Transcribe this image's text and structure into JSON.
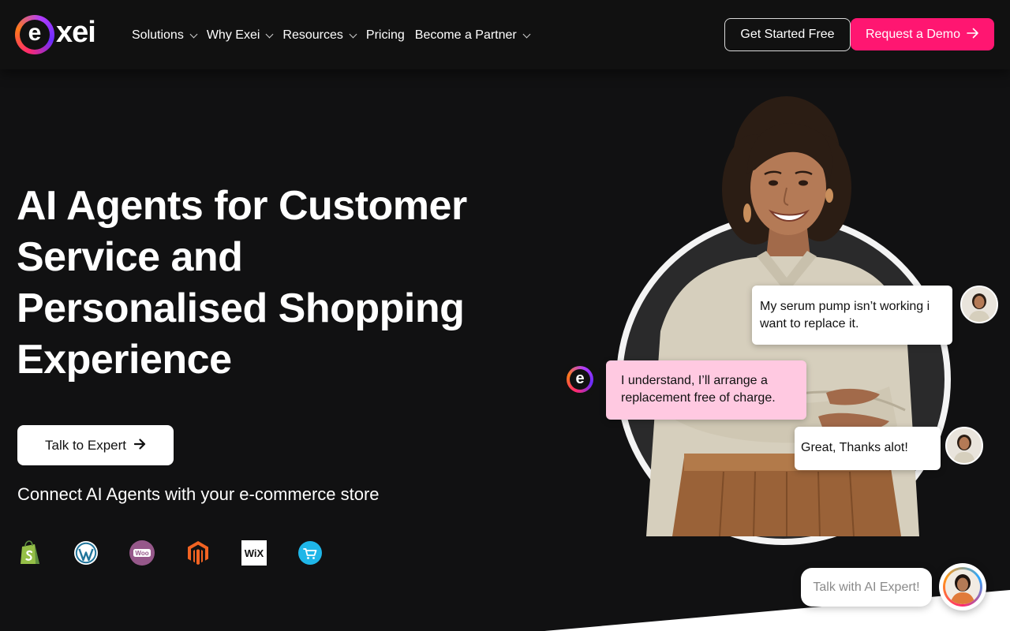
{
  "brand": {
    "logo_letter": "e",
    "logo_text": "xei"
  },
  "nav": {
    "items": [
      {
        "label": "Solutions",
        "has_dropdown": true
      },
      {
        "label": "Why Exei",
        "has_dropdown": true
      },
      {
        "label": "Resources",
        "has_dropdown": true
      },
      {
        "label": "Pricing",
        "has_dropdown": false
      },
      {
        "label": "Become a Partner",
        "has_dropdown": true
      }
    ],
    "get_started_label": "Get Started Free",
    "request_demo_label": "Request a Demo"
  },
  "hero": {
    "title_lines": [
      "AI Agents for Customer",
      "Service and",
      "Personalised Shopping",
      "Experience"
    ],
    "cta_label": "Talk to Expert",
    "connect_text": "Connect AI Agents with your e-commerce store",
    "platforms": [
      "shopify-icon",
      "wordpress-icon",
      "woocommerce-icon",
      "magento-icon",
      "wix-icon",
      "cart-icon"
    ],
    "wix_text": "WiX",
    "woo_text": "Woo"
  },
  "chat_demo": {
    "message_user_1": "My serum pump isn’t working i want to replace it.",
    "message_bot": "I understand, I’ll arrange a replacement free of charge.",
    "message_user_2": "Great, Thanks alot!",
    "bot_badge_letter": "e"
  },
  "chat_widget": {
    "pill_label": "Talk with AI Expert!"
  },
  "colors": {
    "accent": "#ff1671",
    "background": "#111112",
    "bot_bubble": "#ffc9e1"
  }
}
